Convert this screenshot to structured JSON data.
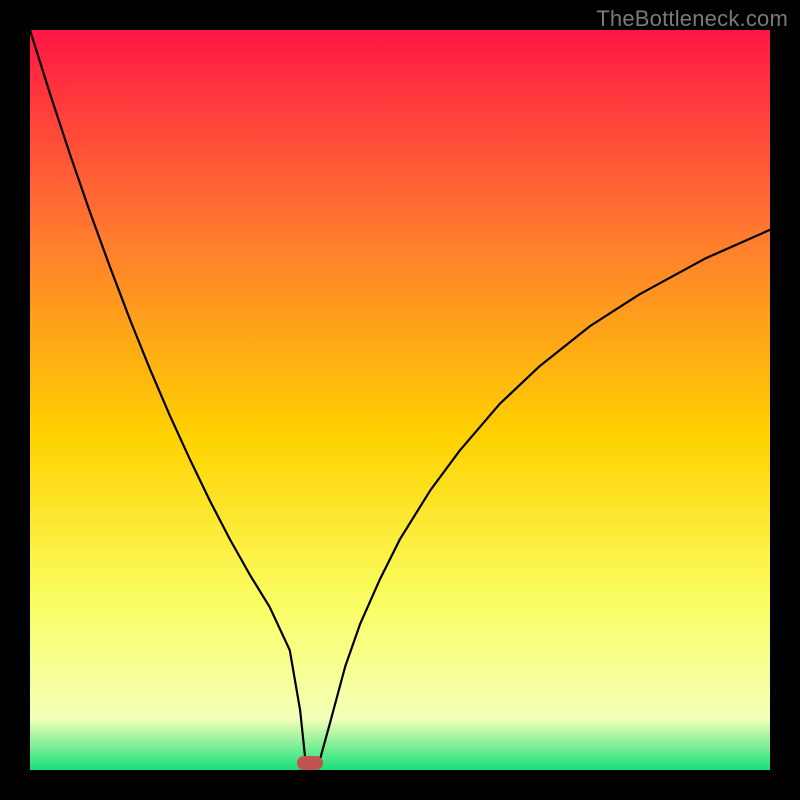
{
  "watermark": "TheBottleneck.com",
  "chart_data": {
    "type": "line",
    "title": "",
    "xlabel": "",
    "ylabel": "",
    "xlim": [
      0,
      100
    ],
    "ylim": [
      0,
      100
    ],
    "grid": false,
    "series": [
      {
        "name": "curve",
        "x": [
          0,
          2.7,
          5.4,
          8.1,
          10.8,
          13.5,
          16.2,
          18.9,
          21.6,
          24.3,
          27.0,
          29.7,
          32.4,
          35.1,
          36.5,
          37.2,
          37.8,
          39.2,
          40.5,
          42.6,
          44.6,
          47.3,
          50.0,
          54.1,
          58.1,
          63.5,
          68.9,
          75.7,
          82.4,
          91.2,
          100.0
        ],
        "values": [
          100.0,
          91.4,
          83.2,
          75.4,
          68.0,
          60.9,
          54.2,
          47.9,
          42.0,
          36.4,
          31.2,
          26.4,
          22.0,
          16.2,
          8.1,
          1.5,
          1.0,
          1.5,
          6.2,
          14.0,
          19.7,
          25.8,
          31.2,
          37.8,
          43.2,
          49.5,
          54.6,
          60.0,
          64.3,
          69.1,
          73.0
        ]
      }
    ],
    "background_gradient": {
      "top": "#ff1744",
      "upper_mid": "#ff7b2e",
      "mid": "#ffd200",
      "lower_mid": "#faff66",
      "lower_band": "#f4ffb8",
      "bottom": "#18e07a"
    },
    "marker": {
      "x_percent": 37.8,
      "y_percent": 1.0,
      "color": "#c0554f"
    }
  }
}
